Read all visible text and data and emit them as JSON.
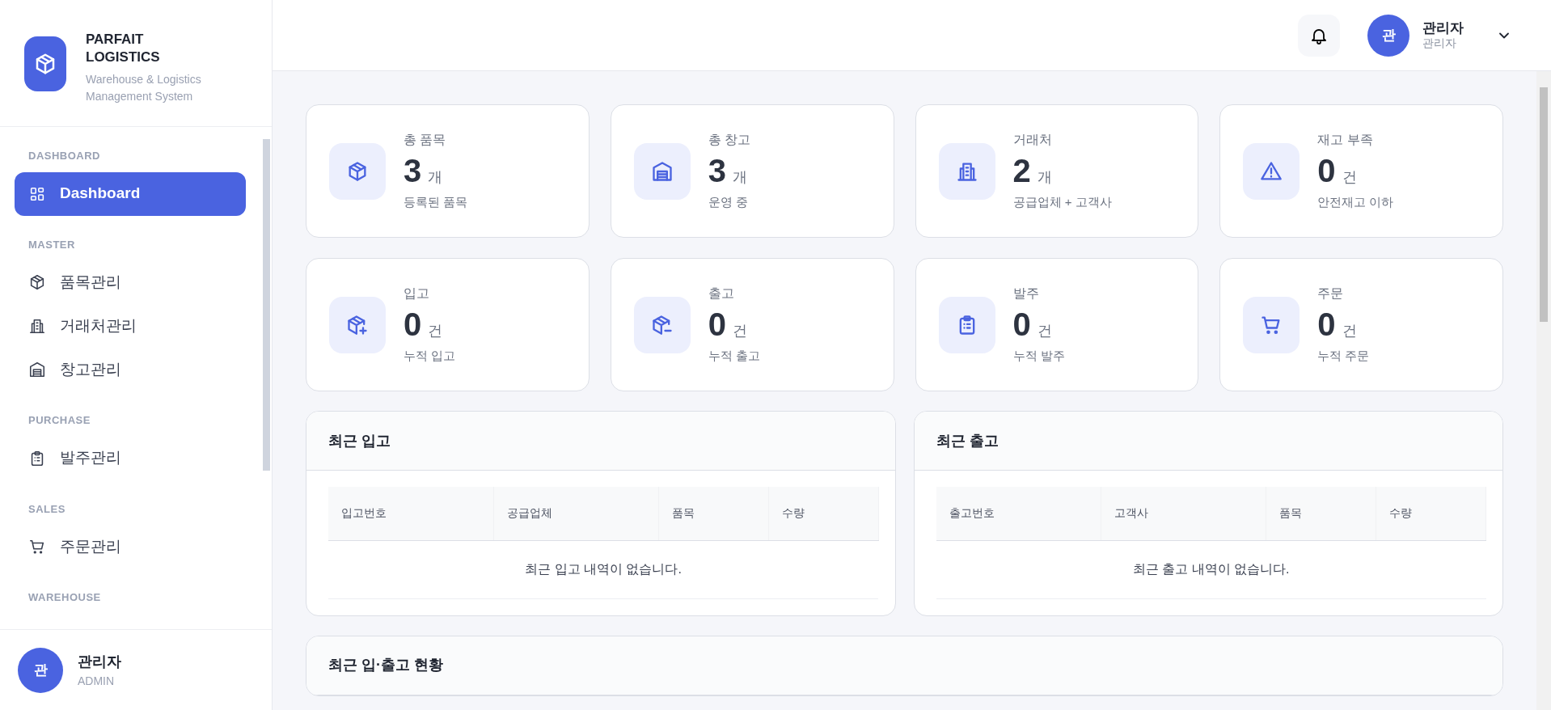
{
  "brand": {
    "title": "PARFAIT LOGISTICS",
    "subtitle": "Warehouse & Logistics Management System"
  },
  "sidebar": {
    "sections": [
      {
        "label": "DASHBOARD",
        "items": [
          {
            "label": "Dashboard",
            "kind": "grid",
            "selected": true
          }
        ]
      },
      {
        "label": "MASTER",
        "items": [
          {
            "label": "품목관리",
            "kind": "box",
            "selected": false
          },
          {
            "label": "거래처관리",
            "kind": "building",
            "selected": false
          },
          {
            "label": "창고관리",
            "kind": "warehouse",
            "selected": false
          }
        ]
      },
      {
        "label": "PURCHASE",
        "items": [
          {
            "label": "발주관리",
            "kind": "clipboard",
            "selected": false
          }
        ]
      },
      {
        "label": "SALES",
        "items": [
          {
            "label": "주문관리",
            "kind": "cart",
            "selected": false
          }
        ]
      },
      {
        "label": "WAREHOUSE"
      }
    ],
    "user": {
      "avatar": "관",
      "name": "관리자",
      "role": "ADMIN"
    }
  },
  "header": {
    "user": {
      "avatar": "관",
      "name": "관리자",
      "role": "관리자"
    }
  },
  "stats": [
    {
      "title": "총 품목",
      "value": "3",
      "unit": "개",
      "caption": "등록된 품목",
      "kind": "box"
    },
    {
      "title": "총 창고",
      "value": "3",
      "unit": "개",
      "caption": "운영 중",
      "kind": "warehouse"
    },
    {
      "title": "거래처",
      "value": "2",
      "unit": "개",
      "caption": "공급업체 + 고객사",
      "kind": "building"
    },
    {
      "title": "재고 부족",
      "value": "0",
      "unit": "건",
      "caption": "안전재고 이하",
      "kind": "warning"
    },
    {
      "title": "입고",
      "value": "0",
      "unit": "건",
      "caption": "누적 입고",
      "kind": "box-plus"
    },
    {
      "title": "출고",
      "value": "0",
      "unit": "건",
      "caption": "누적 출고",
      "kind": "box-minus"
    },
    {
      "title": "발주",
      "value": "0",
      "unit": "건",
      "caption": "누적 발주",
      "kind": "clipboard"
    },
    {
      "title": "주문",
      "value": "0",
      "unit": "건",
      "caption": "누적 주문",
      "kind": "cart"
    }
  ],
  "tables": [
    {
      "title": "최근 입고",
      "columns": [
        "입고번호",
        "공급업체",
        "품목",
        "수량"
      ],
      "empty_message": "최근 입고 내역이 없습니다."
    },
    {
      "title": "최근 출고",
      "columns": [
        "출고번호",
        "고객사",
        "품목",
        "수량"
      ],
      "empty_message": "최근 출고 내역이 없습니다."
    }
  ],
  "panel": {
    "title": "최근 입·출고 현황"
  }
}
